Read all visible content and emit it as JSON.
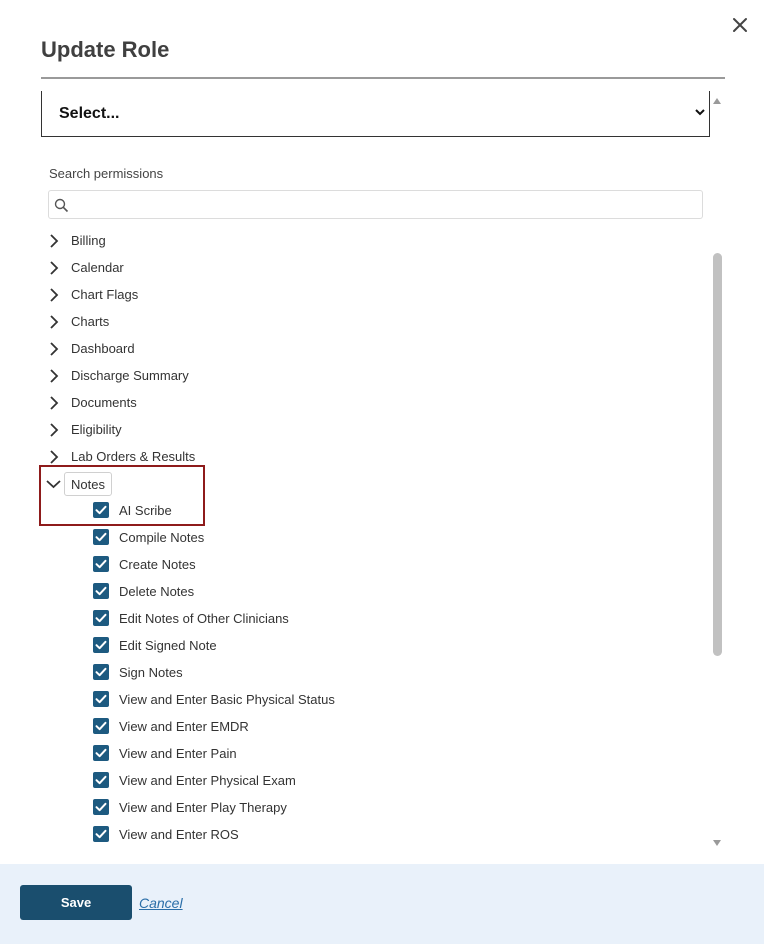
{
  "dialog": {
    "title": "Update Role",
    "close_icon": "close-icon"
  },
  "role_select": {
    "value": "Select..."
  },
  "search": {
    "label": "Search permissions",
    "value": "",
    "placeholder": ""
  },
  "categories": [
    {
      "label": "Billing"
    },
    {
      "label": "Calendar"
    },
    {
      "label": "Chart Flags"
    },
    {
      "label": "Charts"
    },
    {
      "label": "Dashboard"
    },
    {
      "label": "Discharge Summary"
    },
    {
      "label": "Documents"
    },
    {
      "label": "Eligibility"
    },
    {
      "label": "Lab Orders & Results"
    }
  ],
  "notes": {
    "label": "Notes",
    "expanded": true,
    "permissions": [
      {
        "label": "AI Scribe",
        "checked": true
      },
      {
        "label": "Compile Notes",
        "checked": true
      },
      {
        "label": "Create Notes",
        "checked": true
      },
      {
        "label": "Delete Notes",
        "checked": true
      },
      {
        "label": "Edit Notes of Other Clinicians",
        "checked": true
      },
      {
        "label": "Edit Signed Note",
        "checked": true
      },
      {
        "label": "Sign Notes",
        "checked": true
      },
      {
        "label": "View and Enter Basic Physical Status",
        "checked": true
      },
      {
        "label": "View and Enter EMDR",
        "checked": true
      },
      {
        "label": "View and Enter Pain",
        "checked": true
      },
      {
        "label": "View and Enter Physical Exam",
        "checked": true
      },
      {
        "label": "View and Enter Play Therapy",
        "checked": true
      },
      {
        "label": "View and Enter ROS",
        "checked": true
      }
    ]
  },
  "footer": {
    "save_label": "Save",
    "cancel_label": "Cancel"
  },
  "colors": {
    "accent": "#1a4e6e",
    "checkbox": "#1d5a80",
    "highlight": "#8e1b1b",
    "footer_bg": "#e9f1fa",
    "link": "#2a6ea8"
  }
}
